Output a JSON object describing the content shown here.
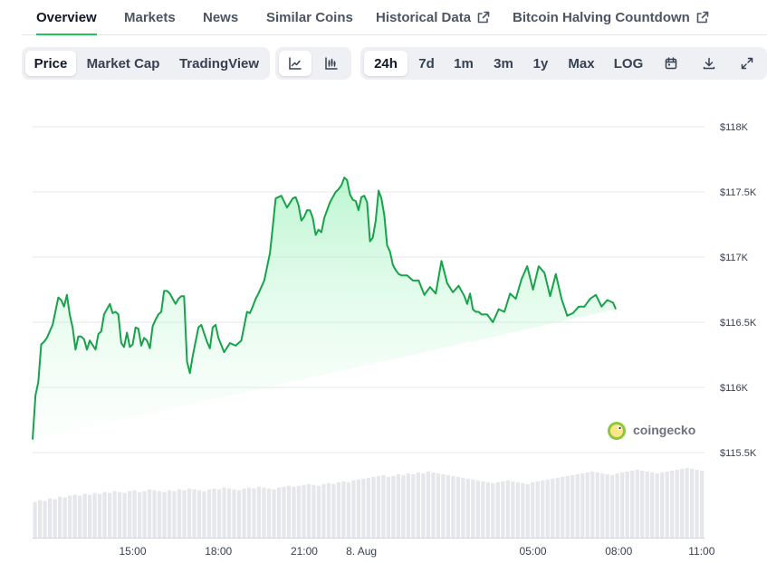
{
  "tabs": [
    {
      "label": "Overview",
      "active": true
    },
    {
      "label": "Markets"
    },
    {
      "label": "News"
    },
    {
      "label": "Similar Coins"
    },
    {
      "label": "Historical Data",
      "external": true
    },
    {
      "label": "Bitcoin Halving Countdown",
      "external": true
    }
  ],
  "toolbar": {
    "chart_kind": [
      "Price",
      "Market Cap",
      "TradingView"
    ],
    "chart_kind_selected": "Price",
    "chart_style_icons": [
      "line-chart-icon",
      "candlestick-chart-icon"
    ],
    "chart_style_selected": "line-chart-icon",
    "ranges": [
      "24h",
      "7d",
      "1m",
      "3m",
      "1y",
      "Max",
      "LOG"
    ],
    "range_selected": "24h",
    "action_icons": [
      "calendar-icon",
      "download-icon",
      "fullscreen-icon"
    ]
  },
  "watermark": "coingecko",
  "colors": {
    "line": "#16a34a",
    "area_top": "#bbf7d0",
    "volume": "#e5e7eb",
    "grid": "#e5e7eb",
    "accent": "#22c55e"
  },
  "chart_data": {
    "type": "area",
    "title": "",
    "xlabel": "",
    "ylabel": "",
    "y_tick_labels": [
      "$118K",
      "$117.5K",
      "$117K",
      "$116.5K",
      "$116K",
      "$115.5K"
    ],
    "y_ticks": [
      118000,
      117500,
      117000,
      116500,
      116000,
      115500
    ],
    "ylim": [
      115500,
      118000
    ],
    "x_tick_labels": [
      "15:00",
      "18:00",
      "21:00",
      "8. Aug",
      "05:00",
      "08:00",
      "11:00"
    ],
    "x_ticks": [
      3,
      6,
      9,
      11,
      17,
      20,
      22.9
    ],
    "x_range": [
      -0.5,
      23.0
    ],
    "grid": true,
    "series": [
      {
        "values_x": [
          -0.5,
          -0.4,
          -0.3,
          -0.2,
          -0.1,
          0.0,
          0.2,
          0.4,
          0.5,
          0.6,
          0.7,
          0.8,
          0.9,
          1.0,
          1.1,
          1.2,
          1.3,
          1.4,
          1.5,
          1.7,
          1.8,
          1.9,
          2.0,
          2.2,
          2.3,
          2.4,
          2.5,
          2.6,
          2.7,
          2.8,
          2.9,
          3.0,
          3.1,
          3.2,
          3.3,
          3.4,
          3.5,
          3.6,
          3.7,
          3.8,
          3.9,
          4.0,
          4.1,
          4.2,
          4.3,
          4.4,
          4.5,
          4.6,
          4.7,
          4.8,
          4.9,
          5.0,
          5.1,
          5.3,
          5.4,
          5.6,
          5.7,
          5.8,
          5.9,
          6.0,
          6.2,
          6.4,
          6.6,
          6.8,
          7.0,
          7.1,
          7.2,
          7.3,
          7.4,
          7.6,
          7.8,
          7.9,
          8.0,
          8.2,
          8.4,
          8.6,
          8.7,
          8.8,
          8.9,
          9.0,
          9.1,
          9.2,
          9.3,
          9.4,
          9.5,
          9.6,
          9.7,
          9.8,
          9.9,
          10.0,
          10.1,
          10.2,
          10.3,
          10.4,
          10.5,
          10.6,
          10.7,
          10.8,
          10.9,
          11.0,
          11.1,
          11.2,
          11.3,
          11.4,
          11.5,
          11.6,
          11.7,
          11.8,
          11.9,
          12.0,
          12.1,
          12.2,
          12.3,
          12.4,
          12.6,
          12.8,
          13.0,
          13.2,
          13.4,
          13.6,
          13.8,
          14.0,
          14.2,
          14.4,
          14.6,
          14.7,
          14.8,
          14.9,
          15.0,
          15.1,
          15.2,
          15.4,
          15.6,
          15.8,
          16.0,
          16.2,
          16.4,
          16.6,
          16.8,
          17.0,
          17.2,
          17.4,
          17.6,
          17.8,
          18.0,
          18.2,
          18.4,
          18.6,
          18.8,
          19.0,
          19.2,
          19.4,
          19.6,
          19.8,
          19.9,
          20.0,
          20.1,
          20.2,
          20.3,
          20.4,
          20.6,
          20.8,
          21.0,
          21.2,
          21.4,
          21.6,
          21.8,
          22.0,
          22.2,
          22.4,
          22.6,
          22.8,
          23.0
        ],
        "values": [
          115600,
          115940,
          116040,
          116330,
          116350,
          116380,
          116480,
          116690,
          116670,
          116620,
          116710,
          116560,
          116460,
          116290,
          116390,
          116390,
          116370,
          116290,
          116360,
          116290,
          116410,
          116430,
          116560,
          116640,
          116570,
          116580,
          116560,
          116340,
          116310,
          116420,
          116310,
          116330,
          116460,
          116450,
          116320,
          116380,
          116360,
          116300,
          116470,
          116520,
          116560,
          116580,
          116740,
          116740,
          116720,
          116680,
          116640,
          116680,
          116700,
          116700,
          116200,
          116110,
          116240,
          116460,
          116480,
          116350,
          116300,
          116460,
          116480,
          116380,
          116270,
          116340,
          116320,
          116360,
          116580,
          116570,
          116620,
          116680,
          116720,
          116820,
          117030,
          117230,
          117450,
          117470,
          117380,
          117450,
          117460,
          117400,
          117280,
          117310,
          117360,
          117360,
          117300,
          117170,
          117210,
          117190,
          117300,
          117360,
          117420,
          117460,
          117500,
          117520,
          117550,
          117610,
          117590,
          117480,
          117440,
          117430,
          117360,
          117460,
          117470,
          117420,
          117120,
          117150,
          117280,
          117510,
          117450,
          117320,
          117090,
          117040,
          116940,
          116900,
          116870,
          116860,
          116860,
          116820,
          116820,
          116710,
          116770,
          116720,
          116970,
          116800,
          116730,
          116780,
          116700,
          116640,
          116720,
          116600,
          116580,
          116580,
          116560,
          116560,
          116500,
          116600,
          116580,
          116720,
          116680,
          116830,
          116930,
          116750,
          116930,
          116880,
          116700,
          116870,
          116680,
          116550,
          116570,
          116620,
          116620,
          116680,
          116710,
          116620,
          116670,
          116650,
          116600
        ],
        "volumes": [
          40,
          42,
          41,
          44,
          43,
          46,
          45,
          47,
          48,
          47,
          49,
          48,
          50,
          49,
          51,
          50,
          52,
          51,
          50,
          52,
          53,
          51,
          52,
          54,
          53,
          52,
          51,
          53,
          52,
          54,
          53,
          55,
          54,
          53,
          52,
          54,
          55,
          54,
          56,
          55,
          54,
          53,
          55,
          56,
          55,
          57,
          56,
          55,
          54,
          56,
          57,
          58,
          57,
          58,
          59,
          60,
          59,
          58,
          60,
          61,
          60,
          62,
          63,
          62,
          64,
          65,
          66,
          67,
          68,
          69,
          70,
          68,
          69,
          71,
          70,
          72,
          71,
          73,
          72,
          74,
          73,
          72,
          71,
          70,
          69,
          68,
          67,
          66,
          65,
          64,
          63,
          62,
          61,
          62,
          63,
          64,
          63,
          62,
          61,
          60,
          62,
          63,
          64,
          65,
          66,
          67,
          68,
          69,
          70,
          71,
          72,
          73,
          74,
          73,
          72,
          71,
          70,
          72,
          73,
          74,
          75,
          76,
          75,
          74,
          73,
          72,
          73,
          74,
          75,
          76,
          77,
          78,
          77,
          76,
          75
        ]
      }
    ]
  }
}
